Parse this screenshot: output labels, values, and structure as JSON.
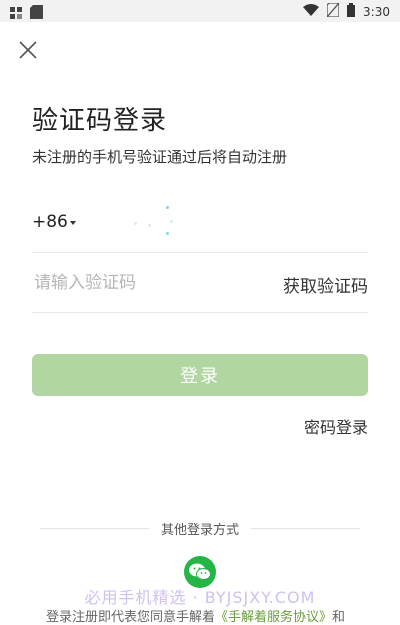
{
  "status_bar": {
    "time": "3:30",
    "icons": [
      "notification-icon",
      "sd-card-icon",
      "wifi-icon",
      "no-sim-icon",
      "battery-icon"
    ]
  },
  "header": {
    "close_icon": "close-icon"
  },
  "title": "验证码登录",
  "subtitle": "未注册的手机号验证通过后将自动注册",
  "phone": {
    "country_code": "+86",
    "value": ""
  },
  "code": {
    "placeholder": "请输入验证码",
    "get_code_label": "获取验证码"
  },
  "login_button": {
    "label": "登录"
  },
  "password_login": "密码登录",
  "other_login": {
    "label": "其他登录方式",
    "wechat_icon": "wechat-icon"
  },
  "watermark": "必用手机精选 · BYJSJXY.COM",
  "agreement": {
    "prefix": "登录注册即代表您同意手解着",
    "link": "《手解着服务协议》",
    "suffix": "和"
  },
  "colors": {
    "accent": "#25b446",
    "login_button_disabled": "#b2d6a2",
    "link": "#6a9c3d"
  }
}
